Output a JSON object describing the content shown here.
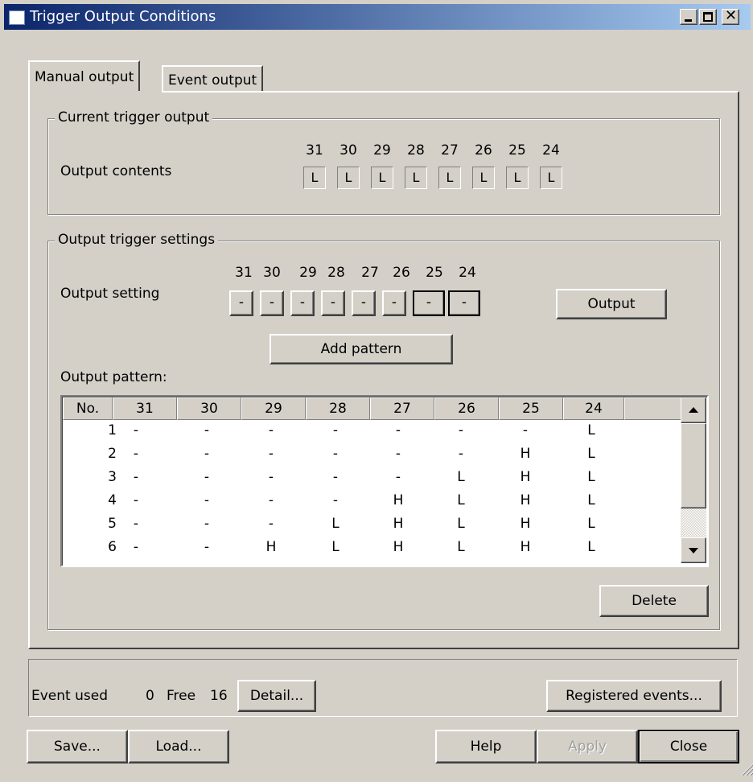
{
  "window": {
    "title": "Trigger Output Conditions"
  },
  "tabs": [
    {
      "label": "Manual output"
    },
    {
      "label": "Event output"
    }
  ],
  "current": {
    "group_title": "Current trigger output",
    "label": "Output contents",
    "bits": [
      "31",
      "30",
      "29",
      "28",
      "27",
      "26",
      "25",
      "24"
    ],
    "values": [
      "L",
      "L",
      "L",
      "L",
      "L",
      "L",
      "L",
      "L"
    ]
  },
  "settings": {
    "group_title": "Output trigger settings",
    "label": "Output setting",
    "bits": [
      "31",
      "30",
      "29",
      "28",
      "27",
      "26",
      "25",
      "24"
    ],
    "values": [
      "-",
      "-",
      "-",
      "-",
      "-",
      "-",
      "-",
      "-"
    ],
    "output_button": "Output",
    "add_pattern_button": "Add pattern",
    "pattern_label": "Output pattern:",
    "delete_button": "Delete"
  },
  "pattern_table": {
    "columns": [
      "No.",
      "31",
      "30",
      "29",
      "28",
      "27",
      "26",
      "25",
      "24"
    ],
    "rows": [
      [
        "1",
        "-",
        "-",
        "-",
        "-",
        "-",
        "-",
        "-",
        "L"
      ],
      [
        "2",
        "-",
        "-",
        "-",
        "-",
        "-",
        "-",
        "H",
        "L"
      ],
      [
        "3",
        "-",
        "-",
        "-",
        "-",
        "-",
        "L",
        "H",
        "L"
      ],
      [
        "4",
        "-",
        "-",
        "-",
        "-",
        "H",
        "L",
        "H",
        "L"
      ],
      [
        "5",
        "-",
        "-",
        "-",
        "L",
        "H",
        "L",
        "H",
        "L"
      ],
      [
        "6",
        "-",
        "-",
        "H",
        "L",
        "H",
        "L",
        "H",
        "L"
      ]
    ]
  },
  "events": {
    "used_label": "Event used",
    "used_value": "0",
    "free_label": "Free",
    "free_value": "16",
    "detail_button": "Detail...",
    "registered_button": "Registered events..."
  },
  "footer": {
    "save": "Save...",
    "load": "Load...",
    "help": "Help",
    "apply": "Apply",
    "close": "Close"
  }
}
